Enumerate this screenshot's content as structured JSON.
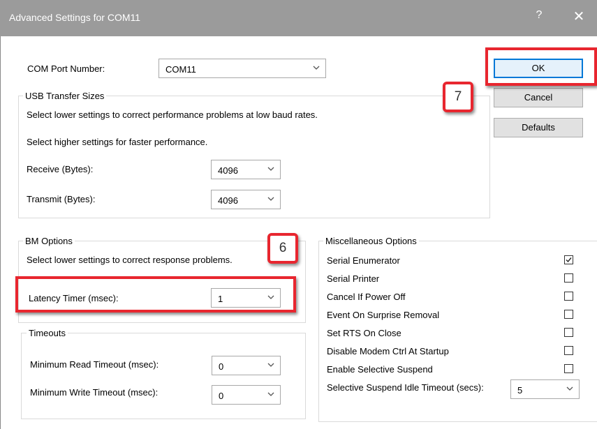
{
  "window": {
    "title": "Advanced Settings for COM11",
    "help_glyph": "?",
    "close_glyph": "✕"
  },
  "com_port": {
    "label": "COM Port Number:",
    "value": "COM11"
  },
  "usb": {
    "title": "USB Transfer Sizes",
    "desc1": "Select lower settings to correct performance problems at low baud rates.",
    "desc2": "Select higher settings for faster performance.",
    "receive_label": "Receive (Bytes):",
    "receive_value": "4096",
    "transmit_label": "Transmit (Bytes):",
    "transmit_value": "4096"
  },
  "bm": {
    "title": "BM Options",
    "desc": "Select lower settings to correct response problems.",
    "latency_label": "Latency Timer (msec):",
    "latency_value": "1"
  },
  "timeouts": {
    "title": "Timeouts",
    "read_label": "Minimum Read Timeout (msec):",
    "read_value": "0",
    "write_label": "Minimum Write Timeout (msec):",
    "write_value": "0"
  },
  "misc": {
    "title": "Miscellaneous Options",
    "options": [
      {
        "label": "Serial Enumerator",
        "checked": true
      },
      {
        "label": "Serial Printer",
        "checked": false
      },
      {
        "label": "Cancel If Power Off",
        "checked": false
      },
      {
        "label": "Event On Surprise Removal",
        "checked": false
      },
      {
        "label": "Set RTS On Close",
        "checked": false
      },
      {
        "label": "Disable Modem Ctrl At Startup",
        "checked": false
      },
      {
        "label": "Enable Selective Suspend",
        "checked": false
      }
    ],
    "idle_label": "Selective Suspend Idle Timeout (secs):",
    "idle_value": "5"
  },
  "buttons": {
    "ok": "OK",
    "cancel": "Cancel",
    "defaults": "Defaults"
  },
  "annotations": {
    "badge_ok": "7",
    "badge_latency": "6"
  },
  "colors": {
    "highlight": "#e8262f",
    "titlebar": "#9b9b9b",
    "default_button": "#0078d7"
  }
}
